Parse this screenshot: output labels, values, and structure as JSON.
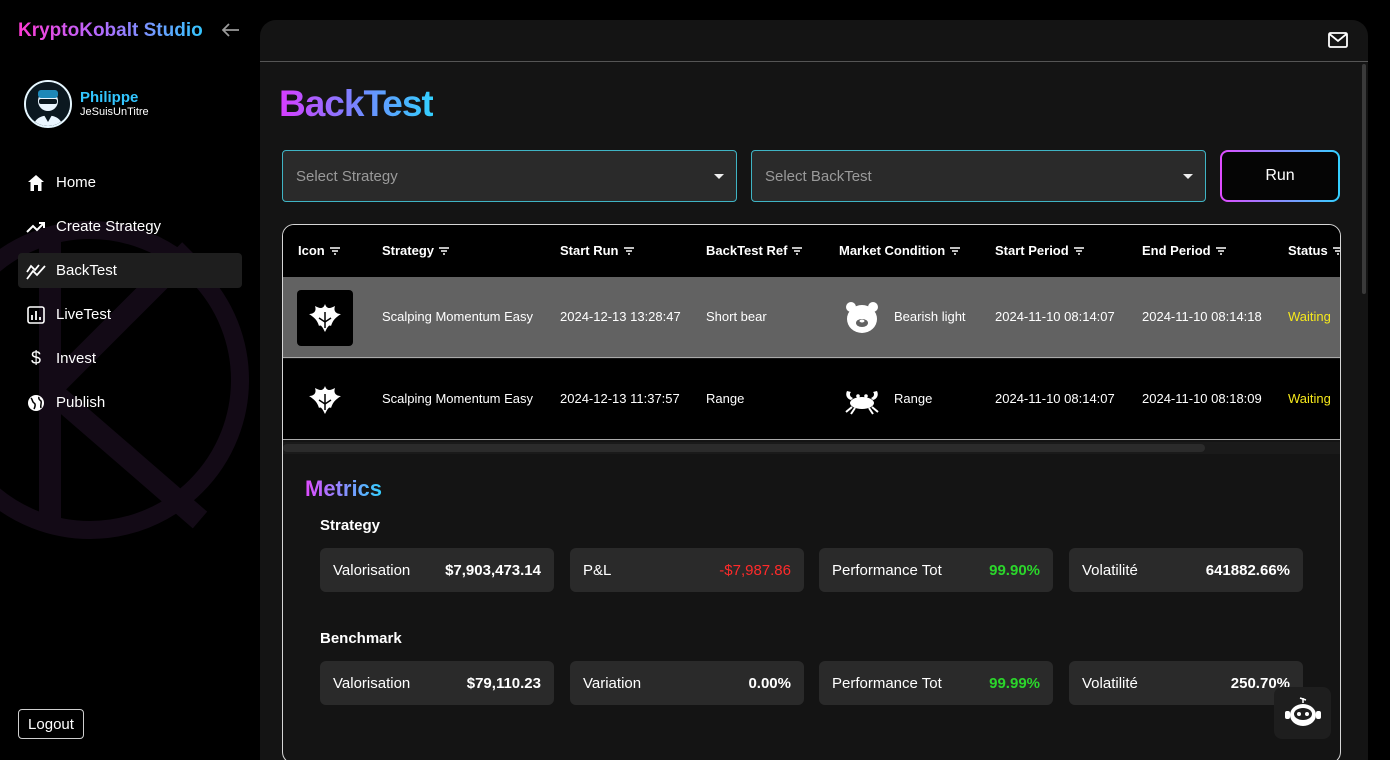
{
  "app": {
    "brand": "KryptoKobalt Studio"
  },
  "user": {
    "name": "Philippe",
    "handle": "JeSuisUnTitre"
  },
  "sidebar": {
    "items": [
      {
        "label": "Home",
        "icon": "home-icon"
      },
      {
        "label": "Create Strategy",
        "icon": "trending-up-icon"
      },
      {
        "label": "BackTest",
        "icon": "backtest-chart-icon",
        "active": true
      },
      {
        "label": "LiveTest",
        "icon": "bar-chart-icon"
      },
      {
        "label": "Invest",
        "icon": "dollar-icon"
      },
      {
        "label": "Publish",
        "icon": "globe-icon"
      }
    ],
    "logout_label": "Logout"
  },
  "page": {
    "title": "BackTest"
  },
  "controls": {
    "strategy_placeholder": "Select Strategy",
    "backtest_placeholder": "Select BackTest",
    "run_label": "Run"
  },
  "table": {
    "columns": [
      "Icon",
      "Strategy",
      "Start Run",
      "BackTest Ref",
      "Market Condition",
      "Start Period",
      "End Period",
      "Status"
    ],
    "rows": [
      {
        "strategy": "Scalping Momentum Easy",
        "start_run": "2024-12-13 13:28:47",
        "backtest_ref": "Short bear",
        "market_icon": "bear-icon",
        "market_condition": "Bearish light",
        "start_period": "2024-11-10 08:14:07",
        "end_period": "2024-11-10 08:14:18",
        "status": "Waiting"
      },
      {
        "strategy": "Scalping Momentum Easy",
        "start_run": "2024-12-13 11:37:57",
        "backtest_ref": "Range",
        "market_icon": "crab-icon",
        "market_condition": "Range",
        "start_period": "2024-11-10 08:14:07",
        "end_period": "2024-11-10 08:18:09",
        "status": "Waiting"
      }
    ]
  },
  "metrics": {
    "title": "Metrics",
    "strategy": {
      "title": "Strategy",
      "cards": [
        {
          "label": "Valorisation",
          "value": "$7,903,473.14",
          "tone": "neutral"
        },
        {
          "label": "P&L",
          "value": "-$7,987.86",
          "tone": "negative"
        },
        {
          "label": "Performance Tot",
          "value": "99.90%",
          "tone": "positive"
        },
        {
          "label": "Volatilité",
          "value": "641882.66%",
          "tone": "neutral"
        }
      ]
    },
    "benchmark": {
      "title": "Benchmark",
      "cards": [
        {
          "label": "Valorisation",
          "value": "$79,110.23",
          "tone": "neutral"
        },
        {
          "label": "Variation",
          "value": "0.00%",
          "tone": "neutral"
        },
        {
          "label": "Performance Tot",
          "value": "99.99%",
          "tone": "positive"
        },
        {
          "label": "Volatilité",
          "value": "250.70%",
          "tone": "neutral"
        }
      ]
    }
  },
  "colors": {
    "accent_cyan": "#33c6ff",
    "accent_magenta": "#e04bff",
    "status_waiting": "#f5e81c",
    "negative": "#ff2a2a",
    "positive": "#2bd62b"
  }
}
